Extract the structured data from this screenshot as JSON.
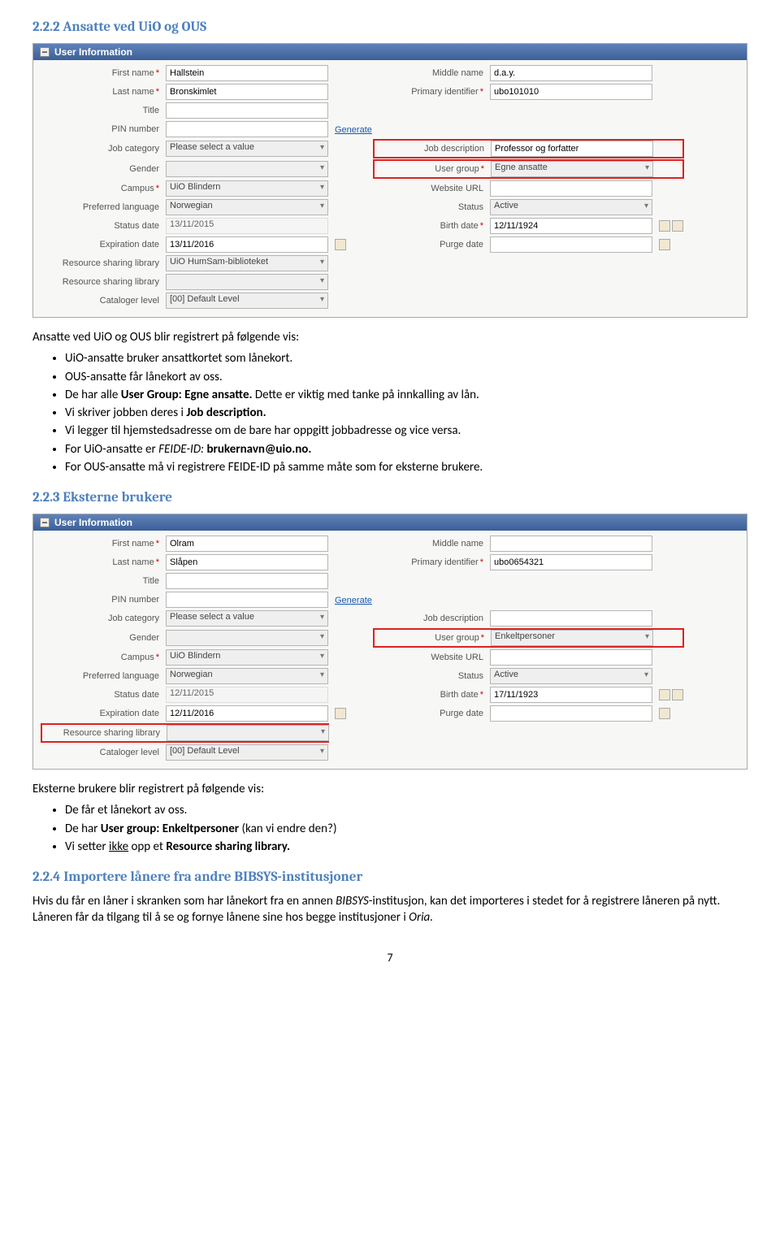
{
  "headings": {
    "h222": "2.2.2 Ansatte ved UiO og OUS",
    "h223": "2.2.3 Eksterne brukere",
    "h224": "2.2.4 Importere lånere fra andre BIBSYS-institusjoner"
  },
  "panel_header": "User Information",
  "labels": {
    "first_name": "First name",
    "last_name": "Last name",
    "title": "Title",
    "pin": "PIN number",
    "job_cat": "Job category",
    "gender": "Gender",
    "campus": "Campus",
    "pref_lang": "Preferred language",
    "status_date": "Status date",
    "exp_date": "Expiration date",
    "rsl": "Resource sharing library",
    "cat_level": "Cataloger level",
    "middle": "Middle name",
    "primary_id": "Primary identifier",
    "generate": "Generate",
    "job_desc": "Job description",
    "user_group": "User group",
    "website": "Website URL",
    "status": "Status",
    "birth": "Birth date",
    "purge": "Purge date"
  },
  "form1": {
    "first_name": "Hallstein",
    "last_name": "Bronskimlet",
    "middle": "d.a.y.",
    "primary_id": "ubo101010",
    "job_cat": "Please select a value",
    "job_desc": "Professor og forfatter",
    "user_group": "Egne ansatte",
    "campus": "UiO Blindern",
    "pref_lang": "Norwegian",
    "status": "Active",
    "status_date": "13/11/2015",
    "birth": "12/11/1924",
    "exp_date": "13/11/2016",
    "rsl1": "UiO HumSam-biblioteket",
    "cat_level": "[00] Default Level"
  },
  "form2": {
    "first_name": "Olram",
    "last_name": "Slåpen",
    "primary_id": "ubo0654321",
    "job_cat": "Please select a value",
    "user_group": "Enkeltpersoner",
    "campus": "UiO Blindern",
    "pref_lang": "Norwegian",
    "status": "Active",
    "status_date": "12/11/2015",
    "birth": "17/11/1923",
    "exp_date": "12/11/2016",
    "cat_level": "[00] Default Level"
  },
  "text": {
    "p1": "Ansatte ved UiO  og OUS blir registrert på følgende vis:",
    "b1": "UiO-ansatte bruker ansattkortet som lånekort.",
    "b2": "OUS-ansatte får lånekort av oss.",
    "b3a": "De har alle ",
    "b3b": "User Group: Egne ansatte.",
    "b3c": " Dette er viktig med tanke på innkalling av lån.",
    "b4a": "Vi skriver jobben deres i ",
    "b4b": "Job description.",
    "b5": "Vi legger til hjemstedsadresse om de bare har oppgitt jobbadresse og vice versa.",
    "b6a": "For UiO-ansatte er ",
    "b6b": "FEIDE-ID: ",
    "b6c": "brukernavn@uio.no.",
    "b7": "For OUS-ansatte må vi registrere FEIDE-ID på samme måte som for eksterne brukere.",
    "p2": "Eksterne brukere blir registrert på følgende vis:",
    "c1": "De får et lånekort av oss.",
    "c2a": "De har ",
    "c2b": "User group: Enkeltpersoner",
    "c2c": " (kan vi endre den?)",
    "c3a": "Vi setter ",
    "c3b": "ikke",
    "c3c": " opp et ",
    "c3d": "Resource sharing library.",
    "p3a": "Hvis du får en låner i skranken som har lånekort fra en annen ",
    "p3b": "BIBSYS",
    "p3c": "-institusjon, kan det importeres i stedet for å registrere låneren på nytt. Låneren får da tilgang til å se og fornye lånene sine hos begge institusjoner i ",
    "p3d": "Oria.",
    "pagenum": "7"
  }
}
